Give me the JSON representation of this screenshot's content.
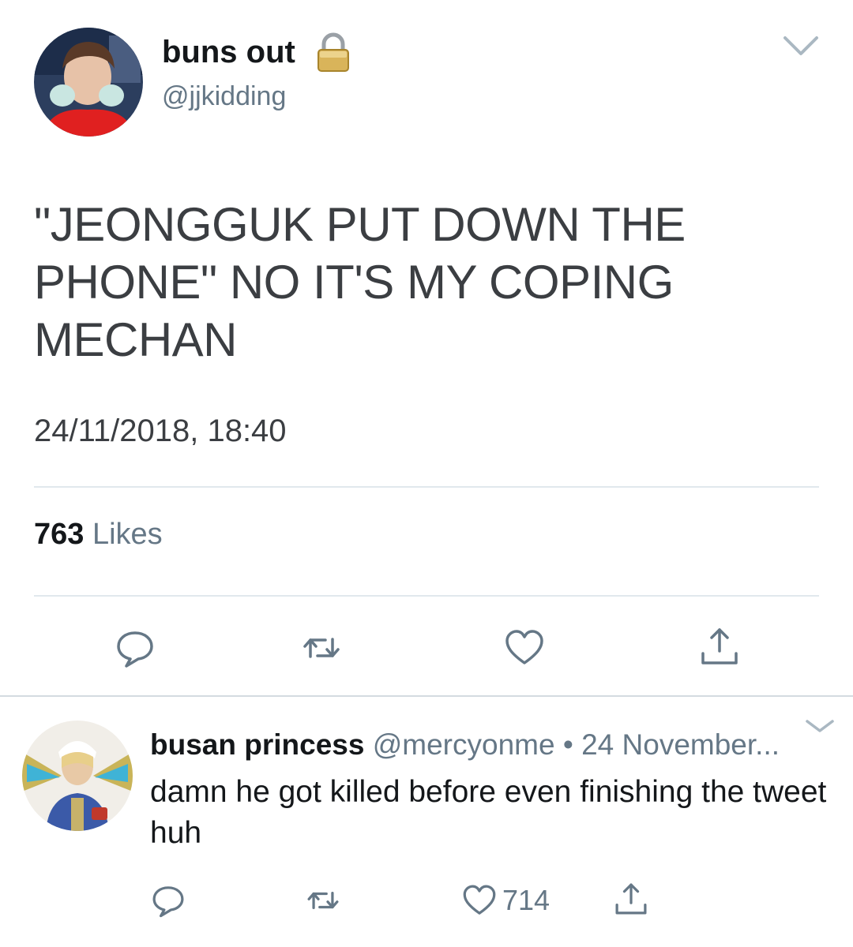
{
  "main_tweet": {
    "display_name": "buns out",
    "handle": "@jjkidding",
    "text": "\"JEONGGUK PUT DOWN THE PHONE\" NO IT'S MY COPING MECHAN",
    "timestamp": "24/11/2018, 18:40",
    "likes_count": "763",
    "likes_label": "Likes",
    "icons": [
      "lock-icon",
      "chevron-down-icon",
      "reply-icon",
      "retweet-icon",
      "heart-icon",
      "share-icon"
    ]
  },
  "reply_tweet": {
    "display_name": "busan princess",
    "handle": "@mercyonme",
    "separator": "•",
    "date": "24 November...",
    "text": "damn he got killed before even finishing the tweet huh",
    "like_count": "714",
    "icons": [
      "chevron-down-icon",
      "reply-icon",
      "retweet-icon",
      "heart-icon",
      "share-icon"
    ]
  },
  "colors": {
    "primary_text": "#14171a",
    "secondary_text": "#657786",
    "tweet_text": "#3b3e42",
    "divider": "#e1e8ed",
    "icon_gray": "#657786"
  }
}
